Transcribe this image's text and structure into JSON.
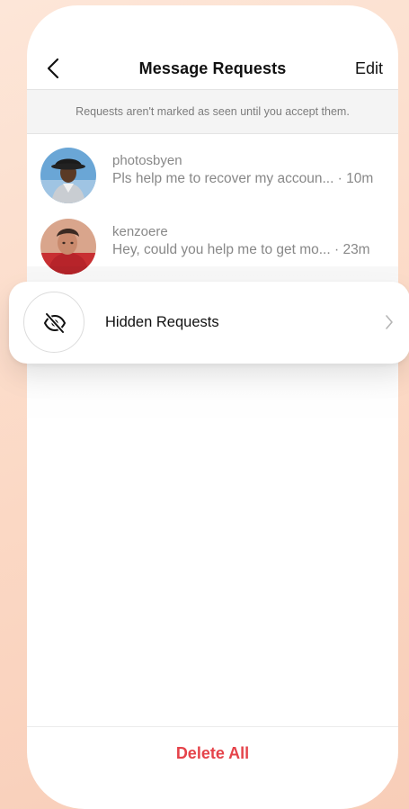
{
  "header": {
    "title": "Message Requests",
    "edit_label": "Edit"
  },
  "notice": "Requests aren't marked as seen until you accept them.",
  "requests": [
    {
      "username": "photosbyen",
      "preview": "Pls help me to recover my accoun... · 10m"
    },
    {
      "username": "kenzoere",
      "preview": "Hey, could you help me to get mo... · 23m"
    }
  ],
  "hidden_requests": {
    "label": "Hidden Requests",
    "icon": "eye-off-icon"
  },
  "footer": {
    "delete_all_label": "Delete All"
  },
  "colors": {
    "accent_red": "#e5434a",
    "secondary_text": "#888888",
    "background_peach": "#fbd8c4"
  }
}
